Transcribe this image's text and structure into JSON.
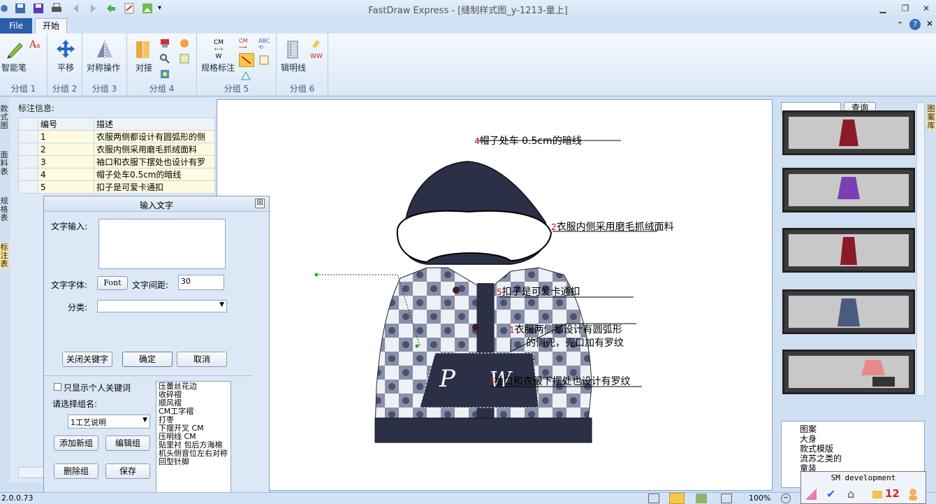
{
  "window": {
    "title": "FastDraw Express - [缝制样式图_y-1213-童上]",
    "minimize": "▁",
    "restore": "❐",
    "close": "✕"
  },
  "tabs": {
    "file": "File",
    "start": "开始"
  },
  "ribbon": {
    "groups": [
      {
        "label": "分组 1",
        "buttons": [
          "智能笔"
        ]
      },
      {
        "label": "分组 2",
        "buttons": [
          "平移"
        ]
      },
      {
        "label": "分组 3",
        "buttons": [
          "对称操作"
        ]
      },
      {
        "label": "分组 4",
        "buttons": [
          "对接"
        ]
      },
      {
        "label": "分组 5",
        "buttons": [
          "规格标注"
        ]
      },
      {
        "label": "分组 6",
        "buttons": [
          "辑明线"
        ]
      }
    ],
    "cm_w": {
      "cm": "CM",
      "w": "W"
    },
    "abc": "ABC"
  },
  "left_vtabs": [
    "款式图",
    "面料表",
    "规格表",
    "标注表"
  ],
  "annotation_panel": {
    "title": "标注信息:",
    "columns": [
      "编号",
      "描述"
    ],
    "rows": [
      {
        "num": "1",
        "desc": "衣服两侧都设计有圆弧形的侧"
      },
      {
        "num": "2",
        "desc": "衣服内侧采用磨毛抓绒面料"
      },
      {
        "num": "3",
        "desc": "袖口和衣服下摆处也设计有罗"
      },
      {
        "num": "4",
        "desc": "帽子处车0.5cm的暗线"
      },
      {
        "num": "5",
        "desc": "扣子是可爱卡通扣"
      }
    ]
  },
  "canvas": {
    "annotations": [
      {
        "num": "4",
        "text": "帽子处车 0.5cm的暗线"
      },
      {
        "num": "2",
        "text": "衣服内侧采用磨毛抓绒面料"
      },
      {
        "num": "5",
        "text": "扣子是可爱卡通扣"
      },
      {
        "num": "1",
        "text": "衣服两侧都设计有圆弧形",
        "text2": "的侧兜，兜口加有罗纹"
      },
      {
        "num": "3",
        "text": "袖口和衣服下摆处也设计有罗纹"
      }
    ],
    "pocket_letters": [
      "P",
      "W"
    ]
  },
  "right_panel": {
    "search_button": "查询",
    "vtab": "图案库",
    "tree_items": [
      "图案",
      "大身",
      "款式模版",
      "流苏之类的",
      "童装"
    ]
  },
  "dialog": {
    "title": "输入文字",
    "close": "☒",
    "text_input_label": "文字输入:",
    "font_label": "文字字体:",
    "font_button": "Font",
    "spacing_label": "文字间距:",
    "spacing_value": "30",
    "category_label": "分类:",
    "close_keywords_button": "关闭关键字",
    "ok_button": "确定",
    "cancel_button": "取消",
    "personal_only_label": "只显示个人关键词",
    "choose_group_label": "请选择组名:",
    "group_selected": "1工艺说明",
    "add_group_button": "添加新组",
    "edit_group_button": "编辑组",
    "delete_group_button": "删除组",
    "save_button": "保存",
    "keywords": [
      "压蕾丝花边",
      "收碎褶",
      "顺风褶",
      "CM工字褶",
      "打枣",
      "下摆开叉 CM",
      "压明线 CM",
      "贴里衬 包后方海棉",
      "机头侧音位左右对称",
      "回型针脚"
    ]
  },
  "statusbar": {
    "version": "2.0.0.73",
    "zoom": "100%",
    "sm_popup": "SM development",
    "badge_count": "12"
  }
}
